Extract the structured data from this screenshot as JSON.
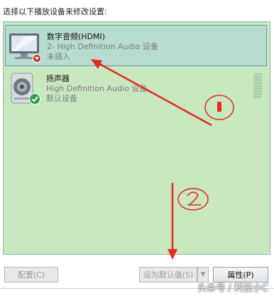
{
  "instruction": "选择以下播放设备来修改设置:",
  "devices": [
    {
      "name": "数字音频(HDMI)",
      "description": "2- High Definition Audio 设备",
      "state": "未插入",
      "icon": "monitor-icon",
      "badge": "unplugged-badge-icon"
    },
    {
      "name": "扬声器",
      "description": "High Definition Audio 设备",
      "state": "默认设备",
      "icon": "speaker-icon",
      "badge": "default-check-icon"
    }
  ],
  "buttons": {
    "configure": "配置(C)",
    "set_default": "设为默认值(S)",
    "properties": "属性(P)"
  },
  "annotations": {
    "marker_1": "1",
    "marker_2": "2"
  },
  "level_meter": {
    "level": 0
  },
  "colors": {
    "list_bg": "#c8e8c0",
    "selected_bg": "#b8dcd2",
    "annotation_red": "#e8281e"
  },
  "watermark": "头条号 / 科技小C"
}
